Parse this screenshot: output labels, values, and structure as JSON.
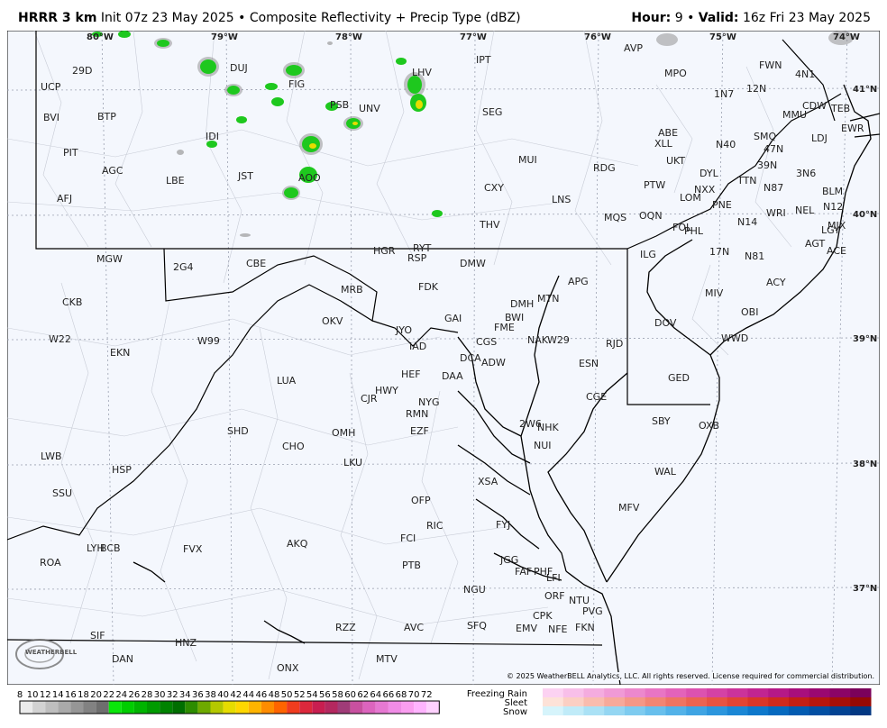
{
  "header": {
    "model": "HRRR 3 km",
    "init": "Init 07z 23 May 2025",
    "sep1": "•",
    "product": "Composite Reflectivity + Precip Type (dBZ)",
    "hour_label": "Hour:",
    "hour_value": "9",
    "sep2": "•",
    "valid_label": "Valid:",
    "valid_value": "16z Fri 23 May 2025"
  },
  "longitude_labels": [
    "80°W",
    "79°W",
    "78°W",
    "77°W",
    "76°W",
    "75°W",
    "74°W"
  ],
  "latitude_labels": [
    "41°N",
    "40°N",
    "39°N",
    "38°N",
    "37°N"
  ],
  "stations": [
    "29D",
    "UCP",
    "BVI",
    "BTP",
    "PIT",
    "AGC",
    "AFJ",
    "DUJ",
    "FIG",
    "IDI",
    "LBE",
    "JST",
    "AOO",
    "PSB",
    "UNV",
    "LHV",
    "IPT",
    "SEG",
    "MUI",
    "CXY",
    "THV",
    "LNS",
    "RDG",
    "AVP",
    "MPO",
    "ABE",
    "XLL",
    "UKT",
    "PTW",
    "MQS",
    "OQN",
    "DYL",
    "NXX",
    "LOM",
    "PNE",
    "PHL",
    "FOL",
    "ILG",
    "1N7",
    "12N",
    "FWN",
    "4N1",
    "CDW",
    "MMU",
    "TEB",
    "EWR",
    "LDJ",
    "SMQ",
    "47N",
    "N40",
    "39N",
    "TTN",
    "N87",
    "3N6",
    "BLM",
    "N12",
    "NEL",
    "WRI",
    "MJX",
    "LGY",
    "AGT",
    "ACE",
    "N14",
    "17N",
    "N81",
    "ACY",
    "MIV",
    "OBI",
    "WWD",
    "DOV",
    "GED",
    "SBY",
    "OXB",
    "WAL",
    "MFV",
    "MGW",
    "2G4",
    "CBE",
    "HGR",
    "RYT",
    "RSP",
    "DMW",
    "FDK",
    "MRB",
    "APG",
    "MTN",
    "DMH",
    "BWI",
    "GAI",
    "FME",
    "NAK",
    "W29",
    "RJD",
    "ESN",
    "CGE",
    "OKV",
    "JYO",
    "IAD",
    "CGS",
    "DCA",
    "ADW",
    "HEF",
    "DAA",
    "HWY",
    "CJR",
    "NYG",
    "RMN",
    "EZF",
    "2W6",
    "NHK",
    "NUI",
    "CKB",
    "W22",
    "EKN",
    "W99",
    "LUA",
    "SHD",
    "CHO",
    "OMH",
    "LKU",
    "LWB",
    "SSU",
    "HSP",
    "OFP",
    "XSA",
    "RIC",
    "FYJ",
    "FCI",
    "PTB",
    "JGG",
    "FAF",
    "PHF",
    "LFI",
    "BCB",
    "ROA",
    "LYH",
    "FVX",
    "AKQ",
    "NGU",
    "ORF",
    "NTU",
    "PVG",
    "CPK",
    "NFE",
    "FKN",
    "SFQ",
    "EMV",
    "AVC",
    "RZZ",
    "MTV",
    "SIF",
    "DAN",
    "HNZ",
    "ONX"
  ],
  "copyright": "© 2025 WeatherBELL Analytics, LLC. All rights reserved. License required for commercial distribution.",
  "legend": {
    "scale_values": [
      "8",
      "10",
      "12",
      "14",
      "16",
      "18",
      "20",
      "22",
      "24",
      "26",
      "28",
      "30",
      "32",
      "34",
      "36",
      "38",
      "40",
      "42",
      "44",
      "46",
      "48",
      "50",
      "52",
      "54",
      "56",
      "58",
      "60",
      "62",
      "64",
      "66",
      "68",
      "70",
      "72"
    ],
    "scale_colors": [
      "#ebebeb",
      "#d2d2d2",
      "#bebebe",
      "#aaaaaa",
      "#969696",
      "#828282",
      "#6e6e6e",
      "#0ae60a",
      "#00cd00",
      "#00b400",
      "#009b00",
      "#008200",
      "#006e00",
      "#2d8c00",
      "#6eaa00",
      "#b4c800",
      "#e6dc00",
      "#ffd700",
      "#ffb400",
      "#ff8c00",
      "#ff6400",
      "#f03c1e",
      "#dc283c",
      "#c81e50",
      "#b4285f",
      "#a03c78",
      "#c850a0",
      "#dc64be",
      "#e678d2",
      "#f08ce6",
      "#fa9ef0",
      "#ffb4ff",
      "#ffd2ff"
    ],
    "freezing_rain_label": "Freezing Rain",
    "sleet_label": "Sleet",
    "snow_label": "Snow",
    "freezing_rain_colors": [
      "#fcd2f2",
      "#f8bfe9",
      "#f4acdf",
      "#f09ad6",
      "#ec88cd",
      "#e875c4",
      "#e363ba",
      "#dc52b0",
      "#d442a5",
      "#cb339b",
      "#c12591",
      "#b51987",
      "#a80f7c",
      "#9a0871",
      "#8b0466",
      "#7b015b"
    ],
    "sleet_colors": [
      "#fde2d8",
      "#fbcfc3",
      "#f9bcae",
      "#f7a99a",
      "#f59786",
      "#f28573",
      "#ef7462",
      "#ec6351",
      "#e85342",
      "#e24434",
      "#da3628",
      "#d02a1e",
      "#c41f15",
      "#b6160e",
      "#a60f08",
      "#960904"
    ],
    "snow_colors": [
      "#d6f4fb",
      "#c0ebf8",
      "#aae1f5",
      "#94d6f2",
      "#7ecbef",
      "#68bfec",
      "#53b2e8",
      "#3fa4e3",
      "#2c96dd",
      "#1b87d5",
      "#0e78cb",
      "#066abf",
      "#035cb1",
      "#024fa2",
      "#024392",
      "#023882"
    ]
  },
  "logo_text": "WEATHERBELL"
}
